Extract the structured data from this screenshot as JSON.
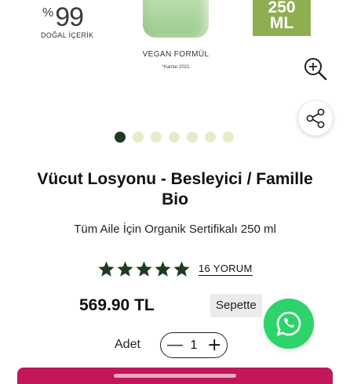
{
  "hero": {
    "percent_symbol": "%",
    "percent_value": "99",
    "natural_label": "DOĞAL İÇERİK",
    "vegan_label": "VEGAN FORMÜL",
    "kantar_note": "*Kantar 2021",
    "badge_line1": "250",
    "badge_line2": "ML"
  },
  "carousel": {
    "total": 7,
    "active_index": 0
  },
  "product": {
    "title": "Vücut Losyonu - Besleyici / Famille Bio",
    "subtitle": "Tüm Aile İçin Organik Sertifikalı 250 ml",
    "rating": 5,
    "reviews_label": "16 YORUM",
    "price": "569.90 TL",
    "cart_status": "Sepette"
  },
  "quantity": {
    "label": "Adet",
    "value": "1",
    "minus": "—",
    "plus": "+"
  },
  "colors": {
    "badge_green": "#8fae4f",
    "star": "#1f3b23",
    "dot_active": "#1f3b23",
    "dot_inactive": "#e4ecc9",
    "whatsapp": "#2cd46b",
    "add_to_cart_bar": "#c2185b"
  },
  "icons": [
    "zoom-in-icon",
    "share-icon",
    "star-icon",
    "whatsapp-icon"
  ]
}
